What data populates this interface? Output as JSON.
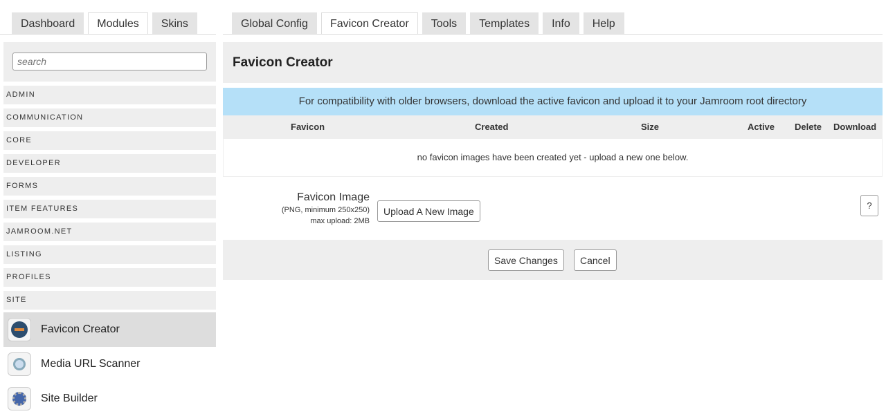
{
  "left_tabs": [
    "Dashboard",
    "Modules",
    "Skins"
  ],
  "right_tabs": [
    "Global Config",
    "Favicon Creator",
    "Tools",
    "Templates",
    "Info",
    "Help"
  ],
  "search": {
    "placeholder": "search"
  },
  "categories": [
    "ADMIN",
    "COMMUNICATION",
    "CORE",
    "DEVELOPER",
    "FORMS",
    "ITEM FEATURES",
    "JAMROOM.NET",
    "LISTING",
    "PROFILES",
    "SITE"
  ],
  "modules": [
    "Favicon Creator",
    "Media URL Scanner",
    "Site Builder"
  ],
  "main": {
    "title": "Favicon Creator",
    "notice": "For compatibility with older browsers, download the active favicon and upload it to your Jamroom root directory",
    "columns": [
      "Favicon",
      "Created",
      "Size",
      "Active",
      "Delete",
      "Download"
    ],
    "empty_message": "no favicon images have been created yet - upload a new one below.",
    "field_label": "Favicon Image",
    "field_hint1": "(PNG, minimum 250x250)",
    "field_hint2": "max upload: 2MB",
    "upload_button": "Upload A New Image",
    "help_button": "?",
    "save_button": "Save Changes",
    "cancel_button": "Cancel"
  }
}
